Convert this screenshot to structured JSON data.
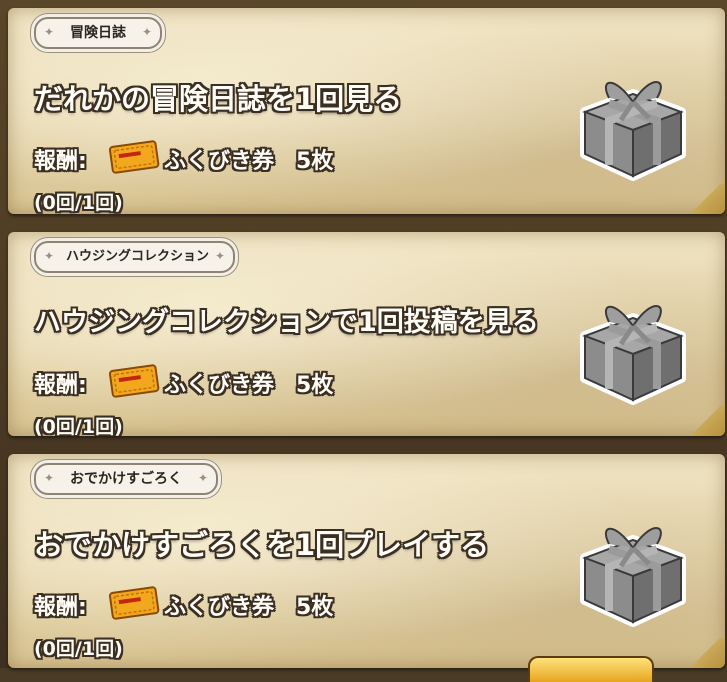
{
  "missions": [
    {
      "category": "冒険日誌",
      "title": "だれかの冒険日誌を1回見る",
      "reward_label": "報酬:",
      "reward_text": "ふくびき券　5枚",
      "progress": "(0回/1回)"
    },
    {
      "category": "ハウジングコレクション",
      "title": "ハウジングコレクションで1回投稿を見る",
      "reward_label": "報酬:",
      "reward_text": "ふくびき券　5枚",
      "progress": "(0回/1回)"
    },
    {
      "category": "おでかけすごろく",
      "title": "おでかけすごろくを1回プレイする",
      "reward_label": "報酬:",
      "reward_text": "ふくびき券　5枚",
      "progress": "(0回/1回)"
    }
  ],
  "icons": {
    "reward": "lottery-ticket-icon",
    "status": "gift-box-icon"
  },
  "colors": {
    "ticket": "#f2a81d",
    "gift": "#8a8a8a",
    "parchment": "#e6d6ae"
  }
}
